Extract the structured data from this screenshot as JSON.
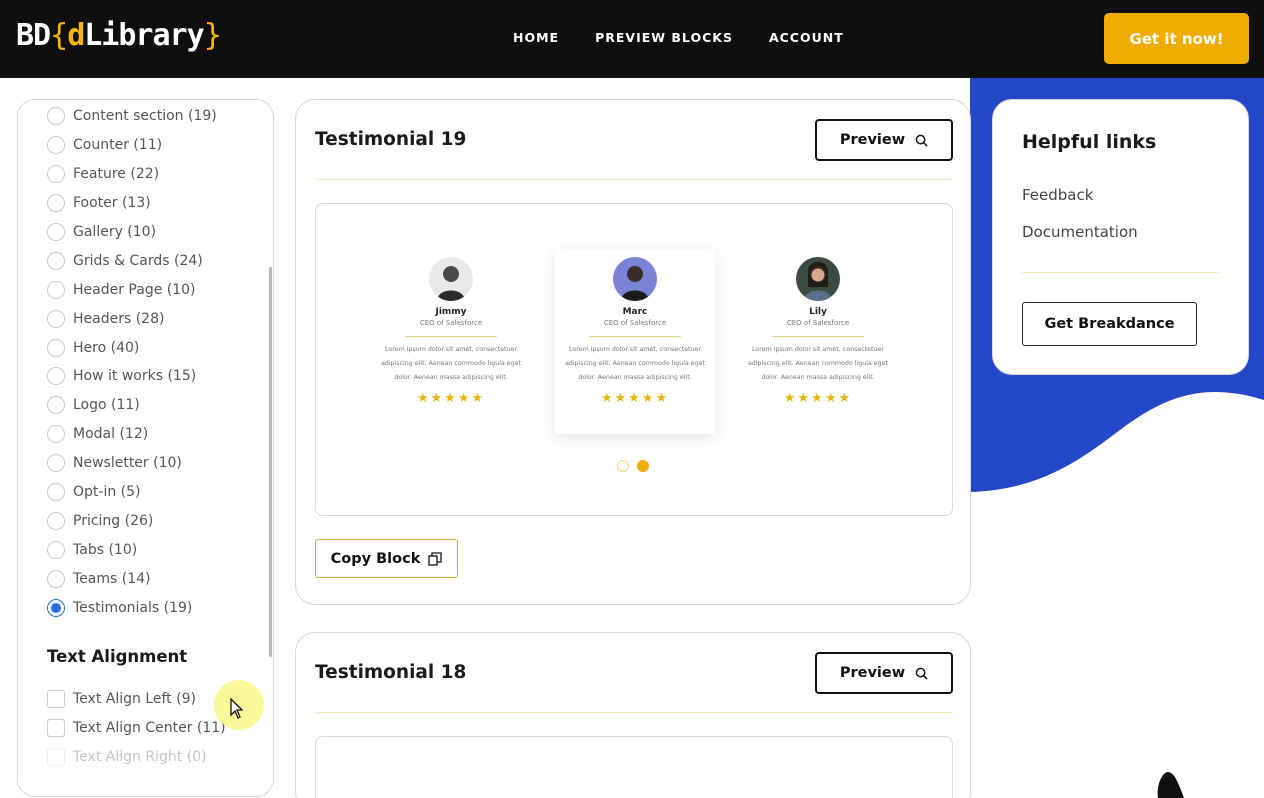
{
  "brand": {
    "logo_prefix": "BD",
    "logo_open": "{",
    "logo_d": "d",
    "logo_word": "Library",
    "logo_close": "}"
  },
  "nav": {
    "items": [
      "HOME",
      "PREVIEW BLOCKS",
      "ACCOUNT"
    ],
    "cta": "Get it now!"
  },
  "sidebar": {
    "categories": [
      "Content section (19)",
      "Counter (11)",
      "Feature (22)",
      "Footer (13)",
      "Gallery (10)",
      "Grids & Cards (24)",
      "Header Page (10)",
      "Headers (28)",
      "Hero (40)",
      "How it works (15)",
      "Logo (11)",
      "Modal (12)",
      "Newsletter (10)",
      "Opt-in (5)",
      "Pricing (26)",
      "Tabs (10)",
      "Teams (14)",
      "Testimonials (19)"
    ],
    "selected_category": "Testimonials (19)",
    "alignment_heading": "Text Alignment",
    "alignments": [
      "Text Align Left (9)",
      "Text Align Center (11)",
      "Text Align Right (0)"
    ]
  },
  "cards": [
    {
      "title": "Testimonial 19",
      "preview_label": "Preview",
      "copy_label": "Copy Block",
      "testimonials": [
        {
          "name": "Jimmy",
          "role": "CEO of Salesforce",
          "text": "Lorem ipsum dolor sit amet, consectetuer adipiscing elit. Aenean commodo ligula eget dolor. Aenean massa adipiscing elit.",
          "stars": "★★★★★",
          "rating": 5
        },
        {
          "name": "Marc",
          "role": "CEO of Salesforce",
          "text": "Lorem ipsum dolor sit amet, consectetuer adipiscing elit. Aenean commodo ligula eget dolor. Aenean massa adipiscing elit.",
          "stars": "★★★★★",
          "rating": 5
        },
        {
          "name": "Lily",
          "role": "CEO of Salesforce",
          "text": "Lorem ipsum dolor sit amet, consectetuer adipiscing elit. Aenean commodo ligula eget dolor. Aenean massa adipiscing elit.",
          "stars": "★★★★★",
          "rating": 5
        }
      ]
    },
    {
      "title": "Testimonial 18",
      "preview_label": "Preview"
    }
  ],
  "helpful": {
    "title": "Helpful links",
    "links": [
      "Feedback",
      "Documentation"
    ],
    "button": "Get Breakdance"
  },
  "colors": {
    "accent": "#f0ac00",
    "header_bg": "#0f0f0f",
    "blob": "#2347c7",
    "radio_selected": "#2a6fdb"
  },
  "icons": [
    "search-icon",
    "copy-icon",
    "mouse-cursor-icon"
  ]
}
